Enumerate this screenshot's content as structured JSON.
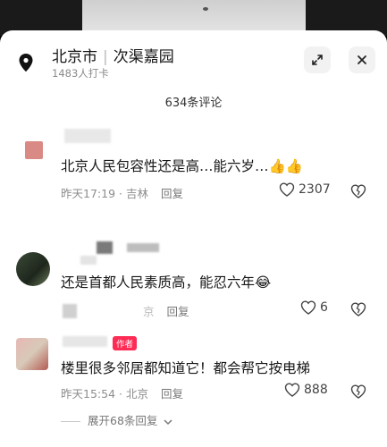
{
  "location": {
    "city": "北京市",
    "place": "次渠嘉园",
    "checkins": "1483人打卡"
  },
  "comments_header": "634条评论",
  "comments": [
    {
      "text": "北京人民包容性还是高…能六岁…",
      "emoji": "👍👍",
      "time": "昨天17:19",
      "region": "吉林",
      "reply_label": "回复",
      "likes": "2307"
    },
    {
      "text": "还是首都人民素质高，能忍六年",
      "emoji": "😂",
      "region": "京",
      "reply_label": "回复",
      "likes": "6"
    },
    {
      "author_tag": "作者",
      "text": "楼里很多邻居都知道它！都会帮它按电梯",
      "time": "昨天15:54",
      "region": "北京",
      "reply_label": "回复",
      "likes": "888",
      "expand_replies": "展开68条回复"
    }
  ],
  "icons": {
    "location": "location-pin-icon",
    "expand": "expand-icon",
    "close": "close-icon",
    "like": "heart-icon",
    "dislike": "broken-heart-icon",
    "chevron": "chevron-down-icon"
  }
}
